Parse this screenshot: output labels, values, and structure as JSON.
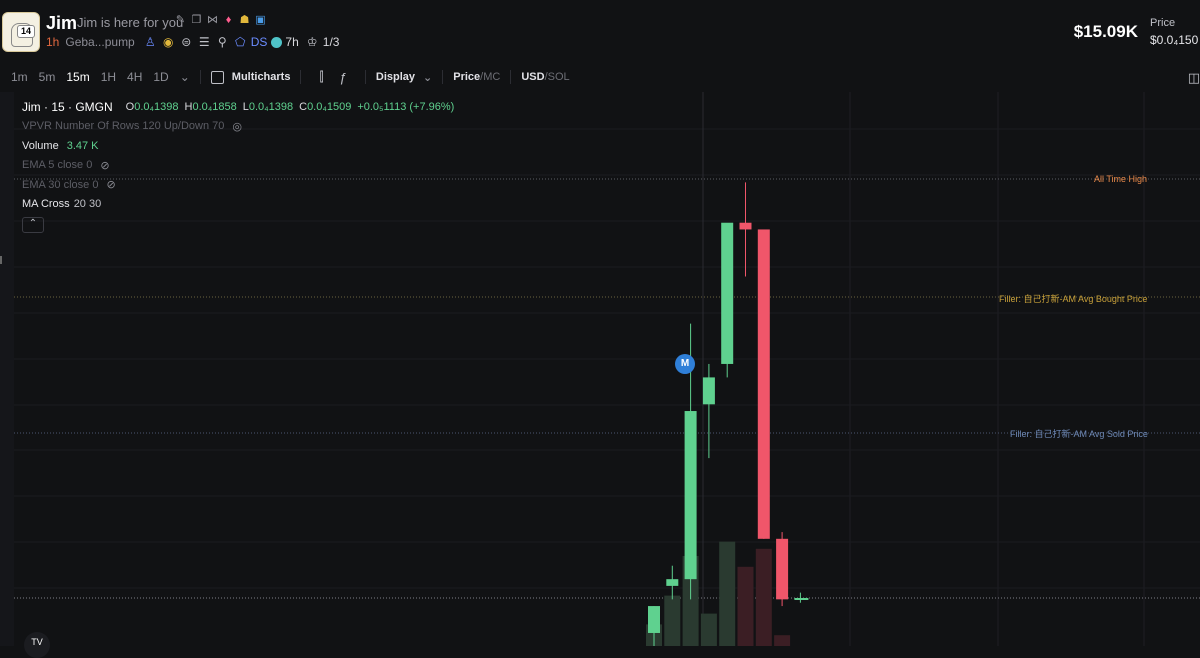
{
  "header": {
    "avatar_badge": "14",
    "token_name": "Jim",
    "tagline": "Jim is here for you",
    "age": "1h",
    "address": "Geba...pump",
    "ds_label": "DS",
    "twitter_age": "7h",
    "holder_ratio": "1/3",
    "market_cap": "$15.09K",
    "price_label": "Price",
    "price_value": "$0.0₄150"
  },
  "toolbar": {
    "timeframes": [
      "1m",
      "5m",
      "15m",
      "1H",
      "4H",
      "1D"
    ],
    "active_timeframe": "15m",
    "multicharts_label": "Multicharts",
    "display_label": "Display",
    "price_label": "Price",
    "mc_label": "MC",
    "usd_label": "USD",
    "sol_label": "SOL"
  },
  "legend": {
    "title": "Jim · 15 · GMGN",
    "o_key": "O",
    "o_val": "0.0₄1398",
    "h_key": "H",
    "h_val": "0.0₄1858",
    "l_key": "L",
    "l_val": "0.0₄1398",
    "c_key": "C",
    "c_val": "0.0₄1509",
    "change": "+0.0₅1113 (+7.96%)",
    "vpvr": "VPVR Number Of Rows 120 Up/Down 70",
    "volume_label": "Volume",
    "volume_value": "3.47 K",
    "ema5": "EMA 5 close 0",
    "ema30": "EMA 30 close 0",
    "ma_cross": "MA Cross",
    "ma_cross_params": "20 30"
  },
  "annotations": {
    "ath": "All Time High",
    "bought": "Filler: 自己打新-AM Avg Bought Price",
    "sold": "Filler: 自己打新-AM Avg Sold Price",
    "marker": "M",
    "logo": "TV"
  },
  "colors": {
    "up": "#5fd18f",
    "down": "#f0566a",
    "ath": "#e8894a",
    "bought": "#c9a13a",
    "sold": "#6f8ab8"
  },
  "chart_data": {
    "type": "candlestick",
    "candles": [
      {
        "o": 1.22e-05,
        "h": 1.26e-05,
        "l": 1.13e-05,
        "c": 1.26e-05
      },
      {
        "o": 1.29e-05,
        "h": 1.32e-05,
        "l": 1.27e-05,
        "c": 1.3e-05
      },
      {
        "o": 1.3e-05,
        "h": 1.68e-05,
        "l": 1.27e-05,
        "c": 1.55e-05
      },
      {
        "o": 1.56e-05,
        "h": 1.62e-05,
        "l": 1.48e-05,
        "c": 1.6e-05
      },
      {
        "o": 1.62e-05,
        "h": 1.75e-05,
        "l": 1.6e-05,
        "c": 1.83e-05
      },
      {
        "o": 1.83e-05,
        "h": 1.89e-05,
        "l": 1.75e-05,
        "c": 1.82e-05
      },
      {
        "o": 1.82e-05,
        "h": 1.82e-05,
        "l": 1.36e-05,
        "c": 1.36e-05
      },
      {
        "o": 1.36e-05,
        "h": 1.37e-05,
        "l": 1.26e-05,
        "c": 1.27e-05
      },
      {
        "o": 1.27e-05,
        "h": 1.28e-05,
        "l": 1.265e-05,
        "c": 1.272e-05
      }
    ],
    "volumes": [
      0.3,
      0.7,
      1.25,
      0.45,
      1.45,
      1.1,
      1.35,
      0.15,
      0.0
    ],
    "reference_lines": {
      "ath": 1.895e-05,
      "avg_bought": 1.7e-05,
      "avg_sold": 1.55e-05,
      "current": 1.272e-05
    }
  }
}
